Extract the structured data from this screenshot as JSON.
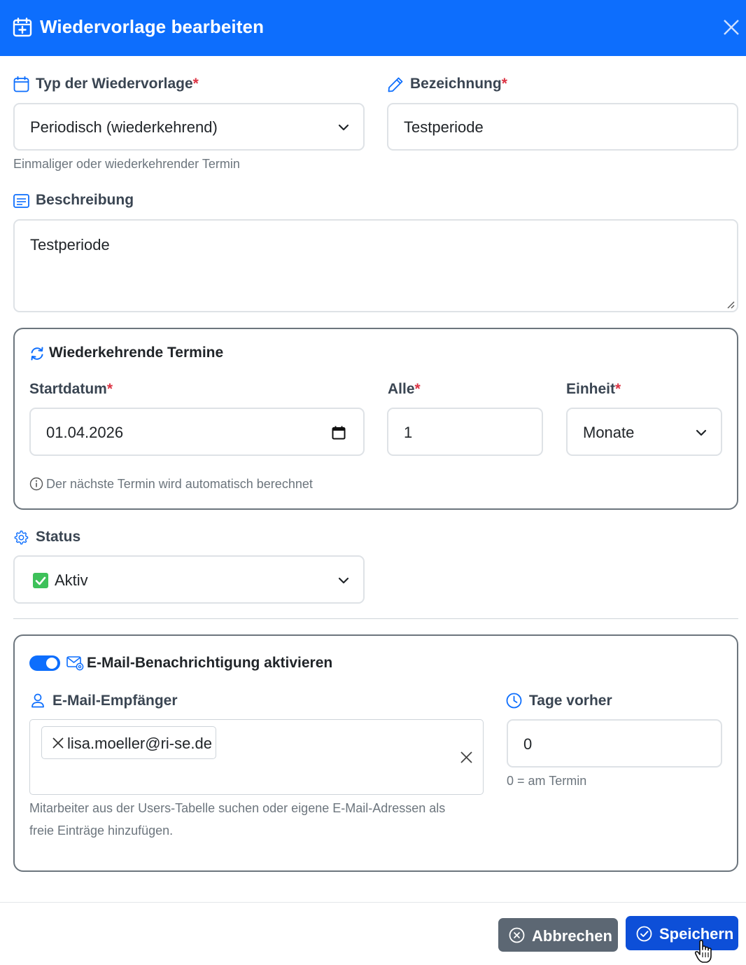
{
  "header": {
    "title": "Wiedervorlage bearbeiten"
  },
  "typ": {
    "label": "Typ der Wiedervorlage",
    "required": "*",
    "value": "Periodisch (wiederkehrend)",
    "hint": "Einmaliger oder wiederkehrender Termin"
  },
  "bezeichnung": {
    "label": "Bezeichnung",
    "required": "*",
    "value": "Testperiode"
  },
  "beschreibung": {
    "label": "Beschreibung",
    "value": "Testperiode"
  },
  "recurring": {
    "title": "Wiederkehrende Termine",
    "start_label": "Startdatum",
    "start_value": "01.04.2026",
    "alle_label": "Alle",
    "alle_value": "1",
    "einheit_label": "Einheit",
    "einheit_value": "Monate",
    "required": "*",
    "info": "Der nächste Termin wird automatisch berechnet"
  },
  "status": {
    "label": "Status",
    "value": "Aktiv"
  },
  "email": {
    "toggle_label": "E-Mail-Benachrichtigung aktivieren",
    "toggle_on": true,
    "recipients_label": "E-Mail-Empfänger",
    "recipient_chip": "lisa.moeller@ri-se.de",
    "recipients_hint_line1": "Mitarbeiter aus der Users-Tabelle suchen oder eigene E-Mail-Adressen als",
    "recipients_hint_line2": "freie Einträge hinzufügen.",
    "days_label": "Tage vorher",
    "days_value": "0",
    "days_hint": "0 = am Termin"
  },
  "footer": {
    "cancel_label": "Abbrechen",
    "save_label": "Speichern"
  },
  "colors": {
    "primary": "#0d6efd",
    "required": "#dc3545",
    "cancel_bg": "#5c6773",
    "save_bg": "#0d4fd8",
    "status_check": "#3ec15a"
  }
}
